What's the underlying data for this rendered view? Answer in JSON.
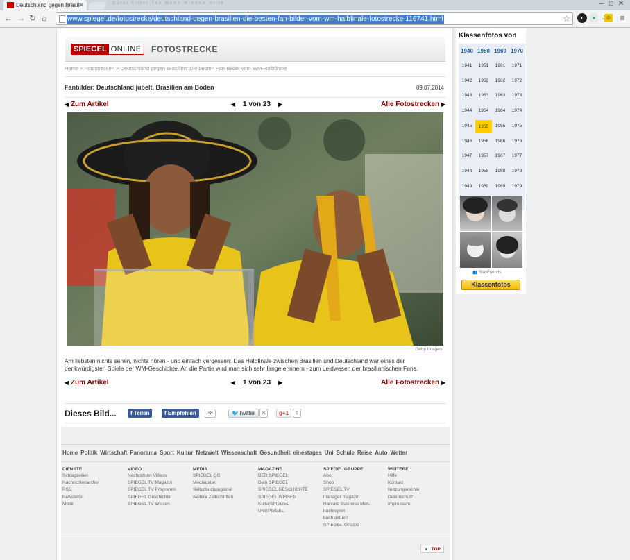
{
  "browser": {
    "tab_title": "Deutschland gegen Brasili",
    "menu_hint": "Datei Filter Tab Menü Window Hilfe",
    "url": "www.spiegel.de/fotostrecke/deutschland-gegen-brasilien-die-besten-fan-bilder-vom-wm-halbfinale-fotostrecke-116741.html"
  },
  "header": {
    "logo_a": "SPIEGEL",
    "logo_b": "ONLINE",
    "section": "FOTOSTRECKE"
  },
  "breadcrumb": "Home > Fotostrecken > Deutschland gegen Brasilien: Die besten Fan-Bilder vom WM-Halbfinale",
  "gallery": {
    "title": "Fanbilder: Deutschland jubelt, Brasilien am Boden",
    "date": "09.07.2014",
    "back_label": "Zum Artikel",
    "counter": "1 von 23",
    "all_label": "Alle Fotostrecken",
    "credit": "Getty Images",
    "caption": "Am liebsten nichts sehen, nichts hören - und einfach vergessen: Das Halbfinale zwischen Brasilien und Deutschland war eines der denkwürdigsten Spiele der WM-Geschichte. An die Partie wird man sich sehr lange erinnern - zum Leidwesen der brasilianischen Fans."
  },
  "share": {
    "heading": "Dieses Bild...",
    "fb_share": "Teilen",
    "fb_like": "Empfehlen",
    "fb_count": "38",
    "twitter": "Twitter",
    "twitter_count": "8",
    "gplus": "+1",
    "gplus_count": "6"
  },
  "footer": {
    "nav": [
      "Home",
      "Politik",
      "Wirtschaft",
      "Panorama",
      "Sport",
      "Kultur",
      "Netzwelt",
      "Wissenschaft",
      "Gesundheit",
      "einestages",
      "Uni",
      "Schule",
      "Reise",
      "Auto",
      "Wetter"
    ],
    "columns": [
      {
        "heading": "DIENSTE",
        "items": [
          "Schlagzeilen",
          "Nachrichtenarchiv",
          "RSS",
          "Newsletter",
          "Mobil"
        ]
      },
      {
        "heading": "VIDEO",
        "items": [
          "Nachrichten Videos",
          "SPIEGEL TV Magazin",
          "SPIEGEL TV Programm",
          "SPIEGEL Geschichte",
          "SPIEGEL TV Wissen"
        ]
      },
      {
        "heading": "MEDIA",
        "items": [
          "SPIEGEL QC",
          "Mediadaten",
          "Selbstbuchungstool",
          "weitere Zeitschriften"
        ]
      },
      {
        "heading": "MAGAZINE",
        "items": [
          "DER SPIEGEL",
          "Dein SPIEGEL",
          "SPIEGEL GESCHICHTE",
          "SPIEGEL WISSEN",
          "KulturSPIEGEL",
          "UniSPIEGEL"
        ]
      },
      {
        "heading": "SPIEGEL GRUPPE",
        "items": [
          "Abo",
          "Shop",
          "SPIEGEL TV",
          "manager magazin",
          "Harvard Business Man.",
          "buchreport",
          "buch aktuell",
          "SPIEGEL-Gruppe"
        ]
      },
      {
        "heading": "WEITERE",
        "items": [
          "Hilfe",
          "Kontakt",
          "Nutzungsrechte",
          "Datenschutz",
          "Impressum"
        ]
      }
    ],
    "top_label": "TOP"
  },
  "ad": {
    "title": "Klassenfotos von",
    "decades": [
      "1940",
      "1950",
      "1960",
      "1970"
    ],
    "selected_year": "1955",
    "stayfriends": "StayFriends",
    "button": "Klassenfotos"
  },
  "colors": {
    "spiegel_red": "#b00000",
    "link_red": "#8b0000",
    "ad_yellow": "#ffcc00",
    "url_highlight": "#3e7fd3"
  }
}
